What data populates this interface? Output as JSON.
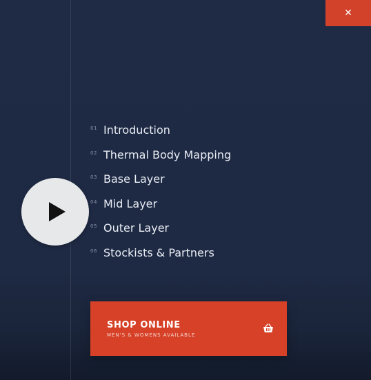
{
  "close": {
    "glyph": "✕",
    "icon": "close-icon"
  },
  "play": {
    "icon": "play-icon"
  },
  "menu": {
    "items": [
      {
        "number": "01",
        "label": "Introduction"
      },
      {
        "number": "02",
        "label": "Thermal Body Mapping"
      },
      {
        "number": "03",
        "label": "Base Layer"
      },
      {
        "number": "04",
        "label": "Mid Layer"
      },
      {
        "number": "05",
        "label": "Outer Layer"
      },
      {
        "number": "06",
        "label": "Stockists & Partners"
      }
    ]
  },
  "shop": {
    "title": "SHOP ONLINE",
    "subtitle": "MEN'S & WOMENS AVAILABLE",
    "icon": "basket-icon"
  },
  "colors": {
    "accent": "#d64127",
    "background": "#1f2b45",
    "play_circle": "#e7e8ea"
  }
}
